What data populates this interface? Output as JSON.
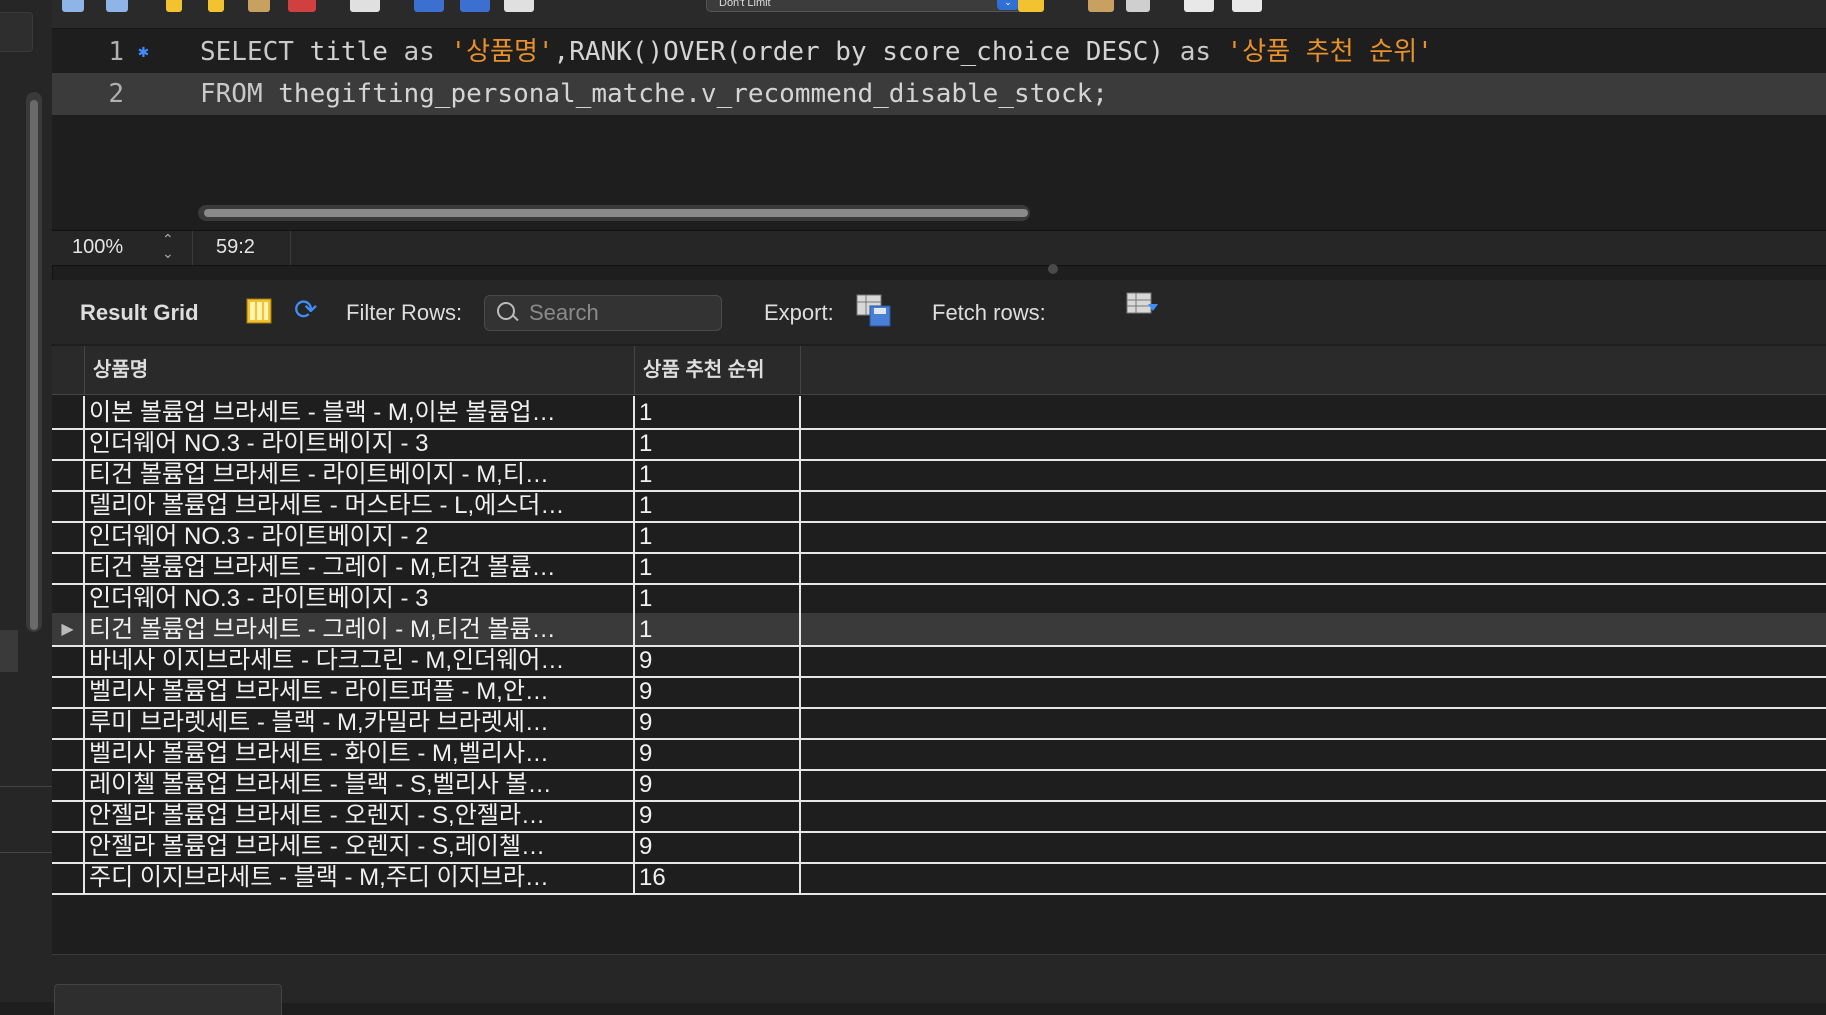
{
  "toolbar": {
    "limit_select_value": "Don't Limit"
  },
  "editor": {
    "lines": [
      {
        "number": "1",
        "tokens": [
          {
            "text": "SELECT",
            "cls": "kw"
          },
          {
            "text": " title ",
            "cls": ""
          },
          {
            "text": "as",
            "cls": "kw"
          },
          {
            "text": " ",
            "cls": ""
          },
          {
            "text": "'상품명'",
            "cls": "str"
          },
          {
            "text": ",RANK()OVER(order by score_choice DESC) ",
            "cls": ""
          },
          {
            "text": "as",
            "cls": "kw"
          },
          {
            "text": " ",
            "cls": ""
          },
          {
            "text": "'상품 추천 순위'",
            "cls": "str"
          }
        ]
      },
      {
        "number": "2",
        "tokens": [
          {
            "text": "FROM",
            "cls": "kw"
          },
          {
            "text": " thegifting_personal_matche.v_recommend_disable_stock;",
            "cls": ""
          }
        ]
      }
    ]
  },
  "status": {
    "zoom": "100%",
    "cursor_position": "59:2"
  },
  "result_bar": {
    "result_grid_label": "Result Grid",
    "filter_rows_label": "Filter Rows:",
    "search_placeholder": "Search",
    "export_label": "Export:",
    "fetch_rows_label": "Fetch rows:"
  },
  "grid": {
    "columns": [
      "상품명",
      "상품 추천 순위"
    ],
    "selected_row_marker": "▶",
    "rows": [
      {
        "title": "이본 볼륨업 브라세트 - 블랙 - M,이본 볼륨업…",
        "rank": "1"
      },
      {
        "title": "인더웨어 NO.3 - 라이트베이지 - 3",
        "rank": "1"
      },
      {
        "title": "티건 볼륨업 브라세트 - 라이트베이지 - M,티…",
        "rank": "1"
      },
      {
        "title": "델리아 볼륨업 브라세트 - 머스타드 - L,에스더…",
        "rank": "1"
      },
      {
        "title": "인더웨어 NO.3 - 라이트베이지 - 2",
        "rank": "1"
      },
      {
        "title": "티건 볼륨업 브라세트 - 그레이 - M,티건 볼륨…",
        "rank": "1"
      },
      {
        "title": "인더웨어 NO.3 - 라이트베이지 - 3",
        "rank": "1"
      },
      {
        "title": "티건 볼륨업 브라세트 - 그레이 - M,티건 볼륨…",
        "rank": "1",
        "selected": true
      },
      {
        "title": "바네사 이지브라세트 - 다크그린 - M,인더웨어…",
        "rank": "9"
      },
      {
        "title": "벨리사 볼륨업 브라세트 - 라이트퍼플 - M,안…",
        "rank": "9"
      },
      {
        "title": "루미 브라렛세트 - 블랙 - M,카밀라 브라렛세…",
        "rank": "9"
      },
      {
        "title": "벨리사 볼륨업 브라세트 - 화이트 - M,벨리사…",
        "rank": "9"
      },
      {
        "title": "레이첼 볼륨업 브라세트 - 블랙 - S,벨리사 볼…",
        "rank": "9"
      },
      {
        "title": "안젤라 볼륨업 브라세트 - 오렌지 - S,안젤라…",
        "rank": "9"
      },
      {
        "title": "안젤라 볼륨업 브라세트 - 오렌지 - S,레이첼…",
        "rank": "9"
      },
      {
        "title": "주디 이지브라세트 - 블랙 - M,주디 이지브라…",
        "rank": "16"
      }
    ]
  }
}
